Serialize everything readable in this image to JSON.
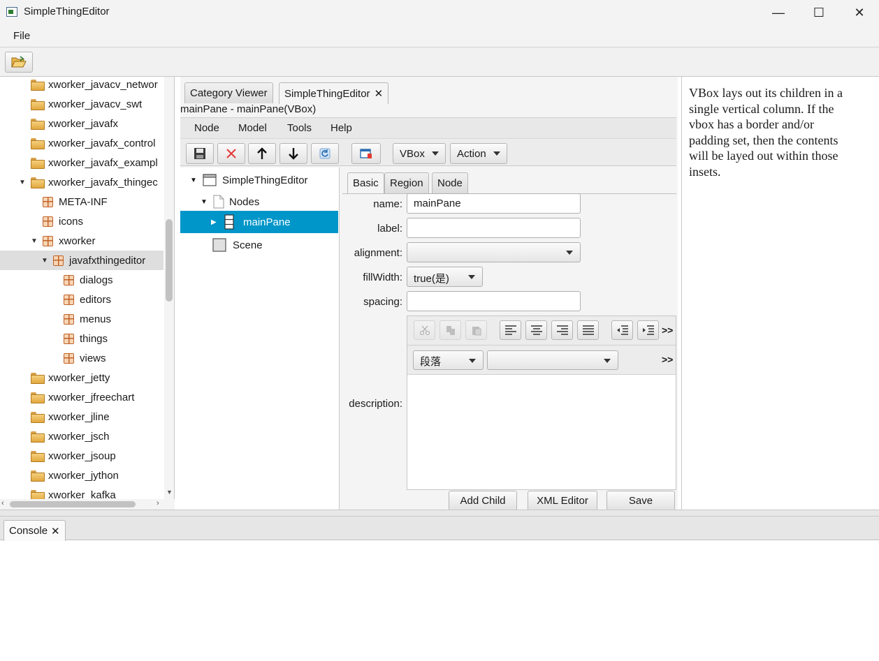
{
  "window": {
    "title": "SimpleThingEditor",
    "minimize": "—",
    "maximize": "☐",
    "close": "✕"
  },
  "menubar": {
    "file": "File"
  },
  "toolbar": {
    "open_icon": "open-folder-icon"
  },
  "left_tree": {
    "items": [
      {
        "label": "xworker_javacv_networ",
        "icon": "folder",
        "level": 0,
        "expanded": null,
        "selected": false
      },
      {
        "label": "xworker_javacv_swt",
        "icon": "folder",
        "level": 0,
        "expanded": null,
        "selected": false
      },
      {
        "label": "xworker_javafx",
        "icon": "folder",
        "level": 0,
        "expanded": null,
        "selected": false
      },
      {
        "label": "xworker_javafx_control",
        "icon": "folder",
        "level": 0,
        "expanded": null,
        "selected": false
      },
      {
        "label": "xworker_javafx_exampl",
        "icon": "folder",
        "level": 0,
        "expanded": null,
        "selected": false
      },
      {
        "label": "xworker_javafx_thingec",
        "icon": "folder",
        "level": 0,
        "expanded": true,
        "selected": false
      },
      {
        "label": "META-INF",
        "icon": "package",
        "level": 1,
        "expanded": null,
        "selected": false
      },
      {
        "label": "icons",
        "icon": "package",
        "level": 1,
        "expanded": null,
        "selected": false
      },
      {
        "label": "xworker",
        "icon": "package",
        "level": 1,
        "expanded": true,
        "selected": false
      },
      {
        "label": "javafxthingeditor",
        "icon": "package",
        "level": 2,
        "expanded": true,
        "selected": true
      },
      {
        "label": "dialogs",
        "icon": "package",
        "level": 3,
        "expanded": null,
        "selected": false
      },
      {
        "label": "editors",
        "icon": "package",
        "level": 3,
        "expanded": null,
        "selected": false
      },
      {
        "label": "menus",
        "icon": "package",
        "level": 3,
        "expanded": null,
        "selected": false
      },
      {
        "label": "things",
        "icon": "package",
        "level": 3,
        "expanded": null,
        "selected": false
      },
      {
        "label": "views",
        "icon": "package",
        "level": 3,
        "expanded": null,
        "selected": false
      },
      {
        "label": "xworker_jetty",
        "icon": "folder",
        "level": 0,
        "expanded": null,
        "selected": false
      },
      {
        "label": "xworker_jfreechart",
        "icon": "folder",
        "level": 0,
        "expanded": null,
        "selected": false
      },
      {
        "label": "xworker_jline",
        "icon": "folder",
        "level": 0,
        "expanded": null,
        "selected": false
      },
      {
        "label": "xworker_jsch",
        "icon": "folder",
        "level": 0,
        "expanded": null,
        "selected": false
      },
      {
        "label": "xworker_jsoup",
        "icon": "folder",
        "level": 0,
        "expanded": null,
        "selected": false
      },
      {
        "label": "xworker_jython",
        "icon": "folder",
        "level": 0,
        "expanded": null,
        "selected": false
      },
      {
        "label": "xworker_kafka",
        "icon": "folder",
        "level": 0,
        "expanded": null,
        "selected": false
      }
    ]
  },
  "editor": {
    "tabs": [
      "Category Viewer",
      "SimpleThingEditor"
    ],
    "tab_close": "✕",
    "subtitle": "mainPane - mainPane(VBox)",
    "menu": [
      "Node",
      "Model",
      "Tools",
      "Help"
    ],
    "toolbar": {
      "vbox_menu": "VBox",
      "action_menu": "Action"
    },
    "node_tree": {
      "root": "SimpleThingEditor",
      "nodes": "Nodes",
      "selected": "mainPane",
      "scene": "Scene"
    },
    "prop_tabs": [
      "Basic",
      "Region",
      "Node"
    ],
    "fields": {
      "name_label": "name:",
      "name_value": "mainPane",
      "label_label": "label:",
      "label_value": "",
      "alignment_label": "alignment:",
      "alignment_value": "",
      "fillwidth_label": "fillWidth:",
      "fillwidth_value": "true(是)",
      "spacing_label": "spacing:",
      "spacing_value": "",
      "description_label": "description:"
    },
    "html_editor": {
      "paragraph_format": "段落",
      "font_family": "",
      "more": ">>"
    },
    "buttons": {
      "add_child": "Add Child",
      "xml_editor": "XML Editor",
      "save": "Save"
    }
  },
  "doc": {
    "lines": [
      "VBox lays out its children in a",
      "single vertical column. If the",
      "vbox has a border and/or",
      "padding set, then the contents",
      "will be layed out within those",
      "insets."
    ]
  },
  "console": {
    "tab": "Console",
    "tab_close": "✕"
  }
}
